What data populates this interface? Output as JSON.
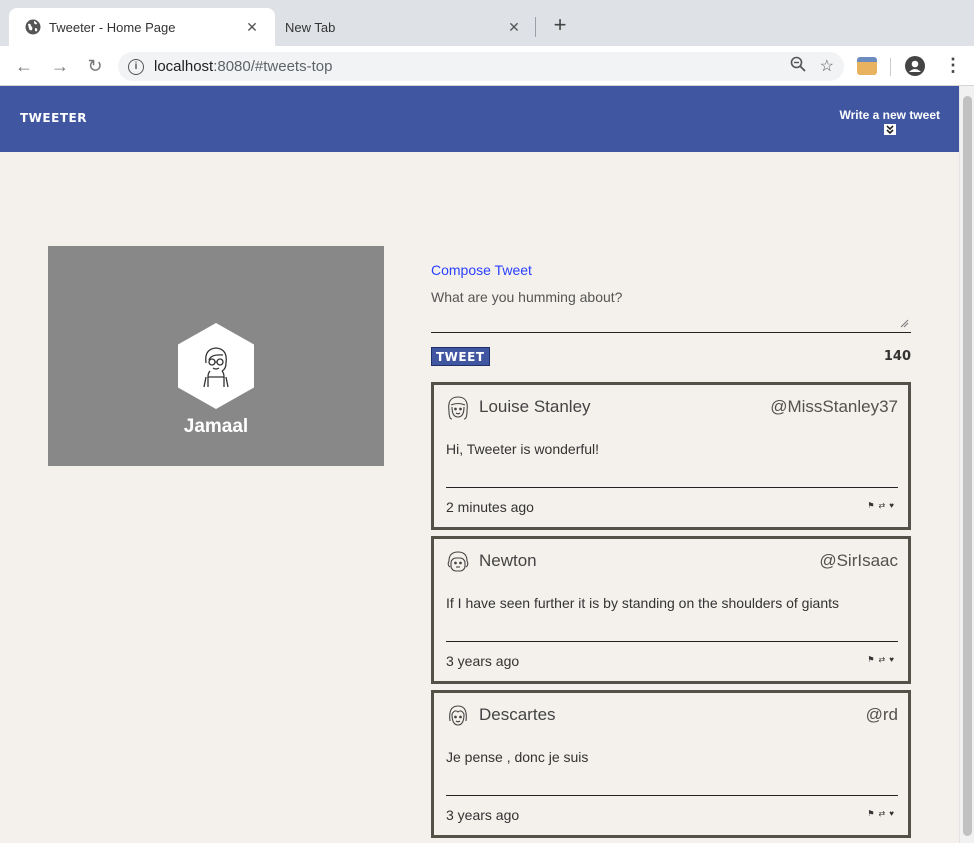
{
  "browser": {
    "tabs": [
      {
        "title": "Tweeter - Home Page",
        "active": true
      },
      {
        "title": "New Tab",
        "active": false
      }
    ],
    "url_host": "localhost",
    "url_rest": ":8080/#tweets-top",
    "icons": [
      "globe-icon",
      "close-icon",
      "new-tab-icon",
      "back-icon",
      "forward-icon",
      "reload-icon",
      "info-icon",
      "zoom-icon",
      "star-icon",
      "extension-icon",
      "profile-icon",
      "menu-icon"
    ]
  },
  "nav": {
    "brand": "TWEETER",
    "write_label": "Write a new tweet",
    "write_icon": "double-chevron-down-icon",
    "bg": "#4056a1"
  },
  "profile": {
    "name": "Jamaal",
    "avatar_icon": "user-avatar-icon"
  },
  "compose": {
    "title": "Compose Tweet",
    "placeholder": "What are you humming about?",
    "submit_label": "TWEET",
    "counter": "140"
  },
  "tweets": [
    {
      "name": "Louise Stanley",
      "handle": "@MissStanley37",
      "content": "Hi, Tweeter is wonderful!",
      "time": "2 minutes ago",
      "avatar_icon": "girl-avatar-icon"
    },
    {
      "name": "Newton",
      "handle": "@SirIsaac",
      "content": "If I have seen further it is by standing on the shoulders of giants",
      "time": "3 years ago",
      "avatar_icon": "man-avatar-icon"
    },
    {
      "name": "Descartes",
      "handle": "@rd",
      "content": "Je pense , donc je suis",
      "time": "3 years ago",
      "avatar_icon": "woman-avatar-icon"
    }
  ],
  "actions": [
    "flag-icon",
    "retweet-icon",
    "heart-icon"
  ]
}
